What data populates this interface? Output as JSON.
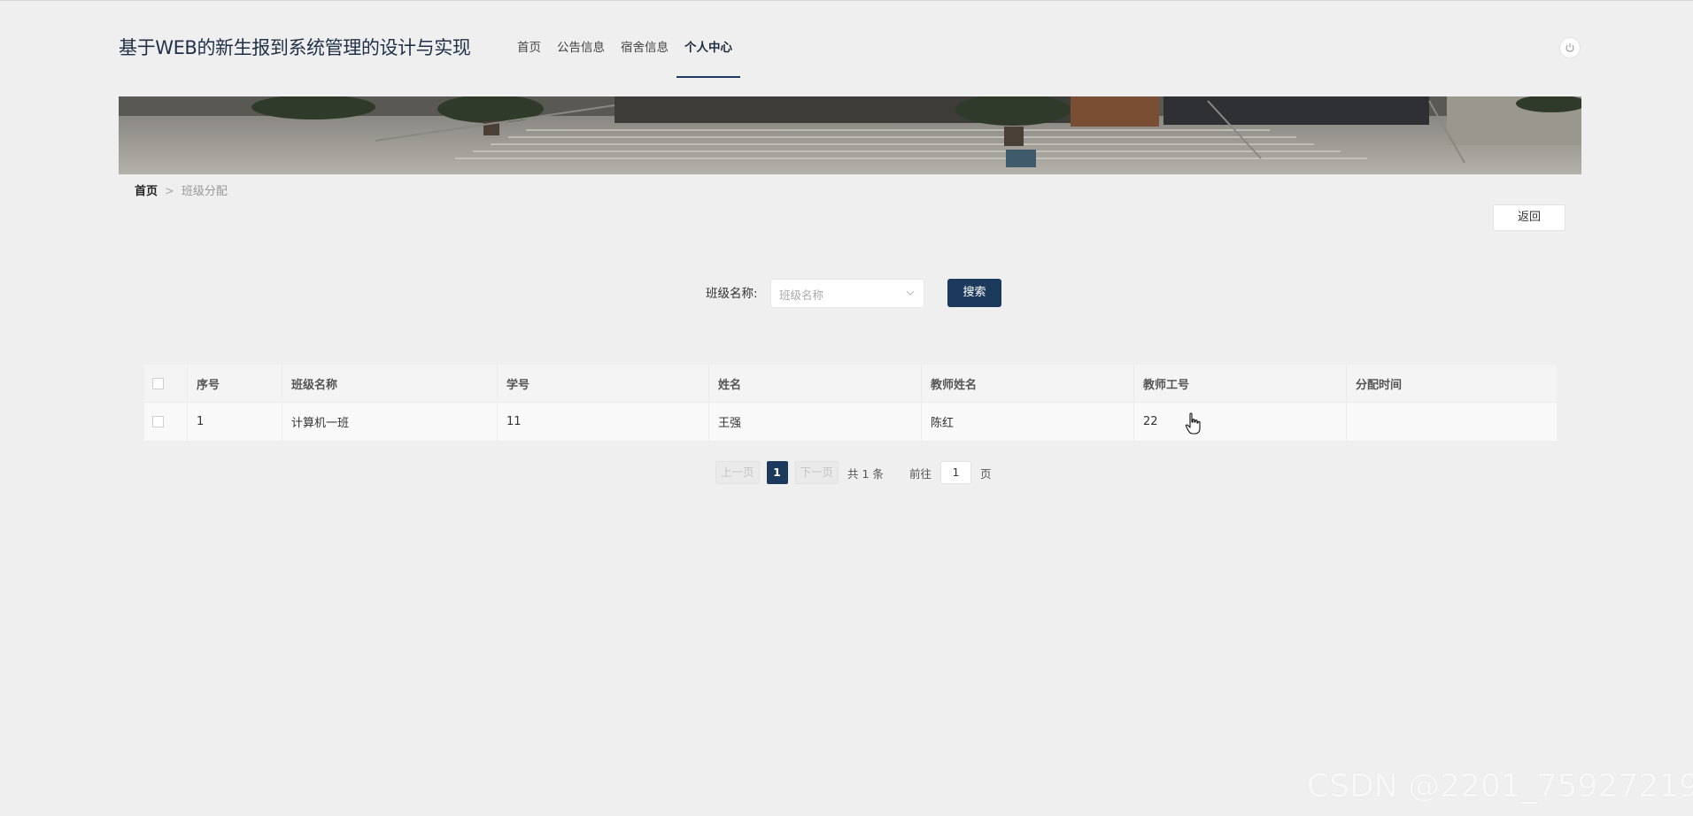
{
  "header": {
    "title": "基于WEB的新生报到系统管理的设计与实现",
    "nav": [
      {
        "label": "首页",
        "active": false
      },
      {
        "label": "公告信息",
        "active": false
      },
      {
        "label": "宿舍信息",
        "active": false
      },
      {
        "label": "个人中心",
        "active": true
      }
    ],
    "power_icon": "power-icon"
  },
  "breadcrumb": {
    "home": "首页",
    "separator": ">",
    "current": "班级分配"
  },
  "back_button": "返回",
  "search": {
    "label": "班级名称:",
    "placeholder": "班级名称",
    "button": "搜索"
  },
  "table": {
    "columns": [
      "序号",
      "班级名称",
      "学号",
      "姓名",
      "教师姓名",
      "教师工号",
      "分配时间"
    ],
    "rows": [
      [
        "1",
        "计算机一班",
        "11",
        "王强",
        "陈红",
        "22",
        ""
      ]
    ]
  },
  "pagination": {
    "prev": "上一页",
    "current_page": "1",
    "next": "下一页",
    "total": "共 1 条",
    "goto": "前往",
    "goto_value": "1",
    "unit": "页"
  },
  "watermark": "CSDN @2201_75927219",
  "colors": {
    "primary": "#1b3a5c",
    "background": "#efefef",
    "title": "#1f3047"
  }
}
